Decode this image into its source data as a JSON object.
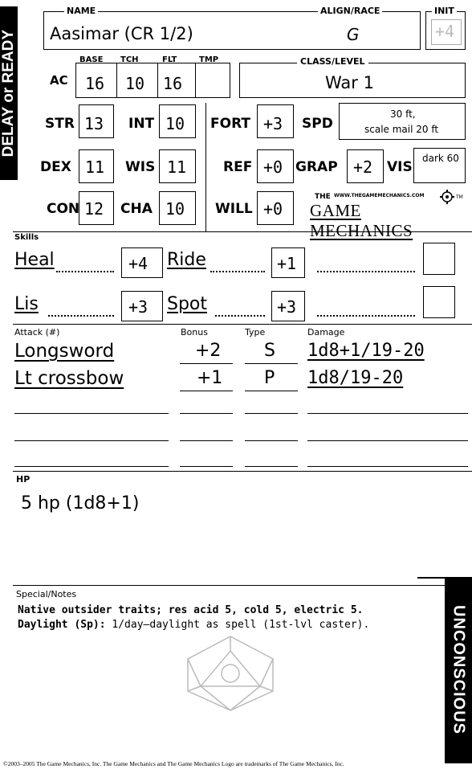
{
  "sidebar": {
    "left_label": "DELAY or READY",
    "right_label": "UNCONSCIOUS"
  },
  "header": {
    "name_label": "NAME",
    "name_value": "Aasimar (CR 1/2)",
    "align_label": "ALIGN/RACE",
    "align_value": "G",
    "init_label": "INIT",
    "init_value": "+4"
  },
  "ac": {
    "label": "AC",
    "base_label": "BASE",
    "base_value": "16",
    "tch_label": "TCH",
    "tch_value": "10",
    "flt_label": "FLT",
    "flt_value": "16",
    "tmp_label": "TMP",
    "tmp_value": ""
  },
  "class_level": {
    "label": "CLASS/LEVEL",
    "value": "War 1"
  },
  "abilities": {
    "str_label": "STR",
    "str_value": "13",
    "int_label": "INT",
    "int_value": "10",
    "dex_label": "DEX",
    "dex_value": "11",
    "wis_label": "WIS",
    "wis_value": "11",
    "con_label": "CON",
    "con_value": "12",
    "cha_label": "CHA",
    "cha_value": "10"
  },
  "saves": {
    "fort_label": "FORT",
    "fort_value": "+3",
    "ref_label": "REF",
    "ref_value": "+0",
    "will_label": "WILL",
    "will_value": "+0"
  },
  "speed": {
    "label": "SPD",
    "line1": "30 ft,",
    "line2": "scale mail 20 ft"
  },
  "grapple": {
    "label": "GRAP",
    "value": "+2"
  },
  "vision": {
    "label": "VIS",
    "value": "dark 60"
  },
  "logo": {
    "the": "THE",
    "url": "WWW.THEGAMEMECHANICS.COM",
    "name": "GAME MECHANICS",
    "tm": "TM"
  },
  "skills": {
    "label": "Skills",
    "rows": [
      [
        {
          "name": "Heal",
          "bonus": "+4"
        },
        {
          "name": "Ride",
          "bonus": "+1"
        }
      ],
      [
        {
          "name": "Lis",
          "bonus": "+3"
        },
        {
          "name": "Spot",
          "bonus": "+3"
        }
      ]
    ]
  },
  "attacks": {
    "headers": {
      "attack": "Attack (#)",
      "bonus": "Bonus",
      "type": "Type",
      "damage": "Damage"
    },
    "rows": [
      {
        "name": "Longsword",
        "bonus": "+2",
        "type": "S",
        "damage": "1d8+1/19-20"
      },
      {
        "name": "Lt crossbow",
        "bonus": "+1",
        "type": "P",
        "damage": "1d8/19-20"
      }
    ]
  },
  "hp": {
    "label": "HP",
    "value": "5 hp (1d8+1)"
  },
  "notes": {
    "label": "Special/Notes",
    "line1": "Native outsider traits; res acid 5, cold 5, electric 5.",
    "line2_bold": "Daylight (Sp):",
    "line2_rest": " 1/day—daylight as spell (1st-lvl caster)."
  },
  "footer": "©2003–2005 The Game Mechanics, Inc. The Game Mechanics and The Game Mechanics Logo are trademarks of The Game Mechanics, Inc."
}
